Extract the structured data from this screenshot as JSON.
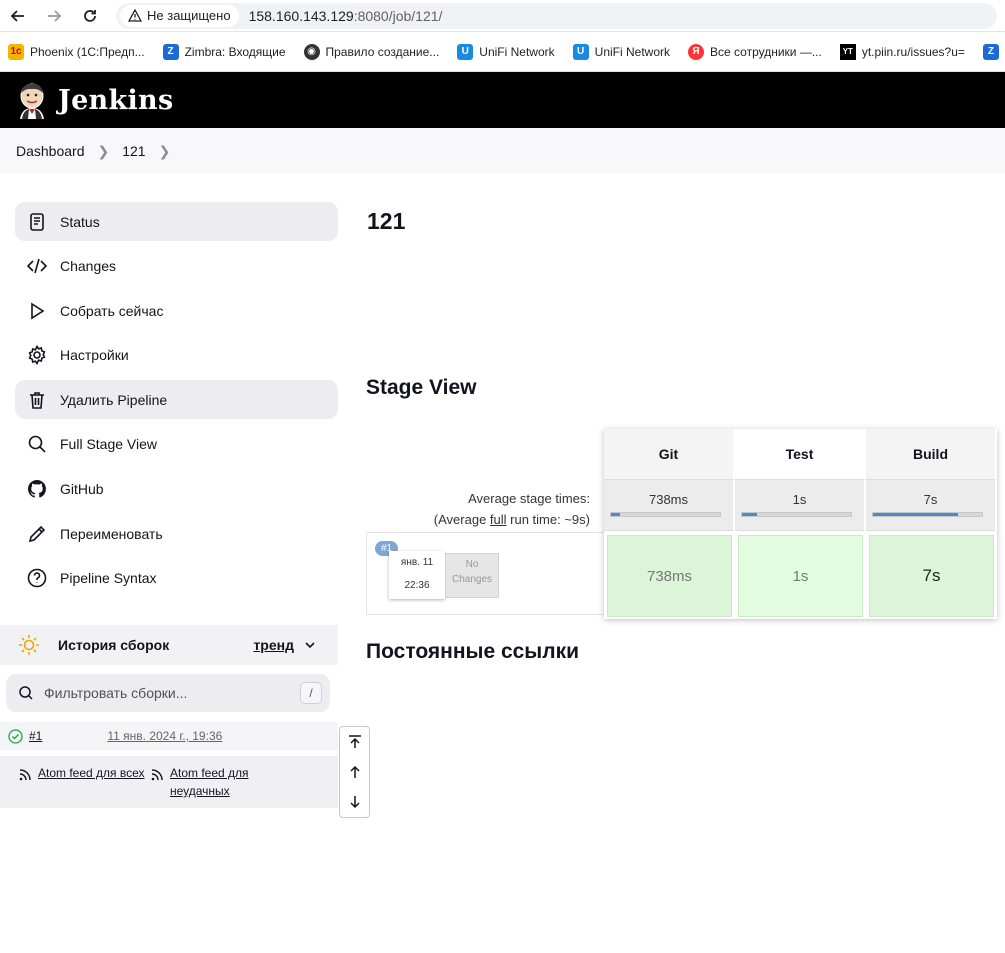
{
  "browser": {
    "secure_label": "Не защищено",
    "url_host": "158.160.143.129",
    "url_rest": ":8080/job/121/",
    "bookmarks": [
      {
        "label": "Phoenix (1С:Предп...",
        "icon": "1c-icon",
        "color": "#f5b400"
      },
      {
        "label": "Zimbra: Входящие",
        "icon": "zimbra-icon",
        "color": "#1d6ad6"
      },
      {
        "label": "Правило создание...",
        "icon": "globe-icon",
        "color": "#333333"
      },
      {
        "label": "UniFi Network",
        "icon": "unifi-icon",
        "color": "#1a8ae0"
      },
      {
        "label": "UniFi Network",
        "icon": "unifi-icon",
        "color": "#1a8ae0"
      },
      {
        "label": "Все сотрудники —...",
        "icon": "yandex-icon",
        "color": "#f33"
      },
      {
        "label": "yt.piin.ru/issues?u=",
        "icon": "youtrack-icon",
        "color": "#000000"
      }
    ]
  },
  "header": {
    "title": "Jenkins"
  },
  "breadcrumb": {
    "items": [
      "Dashboard",
      "121"
    ]
  },
  "sidebar": {
    "items": [
      {
        "label": "Status",
        "icon": "status-icon"
      },
      {
        "label": "Changes",
        "icon": "code-icon"
      },
      {
        "label": "Собрать сейчас",
        "icon": "play-icon"
      },
      {
        "label": "Настройки",
        "icon": "gear-icon"
      },
      {
        "label": "Удалить Pipeline",
        "icon": "trash-icon"
      },
      {
        "label": "Full Stage View",
        "icon": "search-icon"
      },
      {
        "label": "GitHub",
        "icon": "github-icon"
      },
      {
        "label": "Переименовать",
        "icon": "pencil-icon"
      },
      {
        "label": "Pipeline Syntax",
        "icon": "help-icon"
      }
    ]
  },
  "history": {
    "title": "История сборок",
    "trend": "тренд",
    "filter_placeholder": "Фильтровать сборки...",
    "filter_shortcut": "/",
    "build": {
      "number": "#1",
      "date": "11 янв. 2024 г., 19:36",
      "status": "success"
    },
    "feed_all": "Atom feed для всех",
    "feed_failed": "Atom feed для неудачных"
  },
  "main": {
    "title": "121",
    "stage_view_title": "Stage View",
    "avg_stage_times": "Average stage times:",
    "avg_run_prefix": "(Average ",
    "avg_run_link": "full",
    "avg_run_suffix": " run time: ~9s)",
    "run": {
      "badge": "#1",
      "date": "янв. 11",
      "time": "22:36",
      "changes": "No Changes"
    },
    "stages": [
      {
        "name": "Git",
        "avg": "738ms",
        "cell": "738ms",
        "bar_fraction": 0.08
      },
      {
        "name": "Test",
        "avg": "1s",
        "cell": "1s",
        "bar_fraction": 0.14
      },
      {
        "name": "Build",
        "avg": "7s",
        "cell": "7s",
        "bar_fraction": 0.78
      }
    ],
    "permalinks_title": "Постоянные ссылки"
  }
}
